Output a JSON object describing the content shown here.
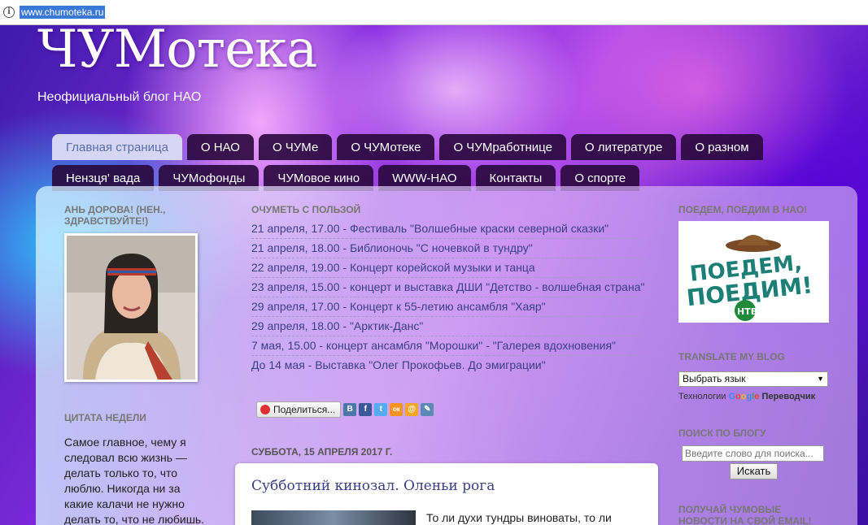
{
  "browser": {
    "url": "www.chumoteka.ru"
  },
  "header": {
    "title": "ЧУМотека",
    "subtitle": "Неофициальный блог НАО"
  },
  "tabs": [
    {
      "label": "Главная страница",
      "active": true
    },
    {
      "label": "О НАО"
    },
    {
      "label": "О ЧУМе"
    },
    {
      "label": "О ЧУМотеке"
    },
    {
      "label": "О ЧУМработнице"
    },
    {
      "label": "О литературе"
    },
    {
      "label": "О разном"
    },
    {
      "label": "Нензця' вада"
    },
    {
      "label": "ЧУМофонды"
    },
    {
      "label": "ЧУМовое кино"
    },
    {
      "label": "WWW-НАО"
    },
    {
      "label": "Контакты"
    },
    {
      "label": "О спорте"
    }
  ],
  "left": {
    "greeting_title": "АНЬ ДОРОВА! (НЕН., ЗДРАВСТВУЙТЕ!)",
    "quote_title": "ЦИТАТА НЕДЕЛИ",
    "quote_text": "Самое главное, чему я следовал всю жизнь — делать только то, что люблю. Никогда ни за какие калачи не нужно делать то, что не любишь."
  },
  "center": {
    "events_title": "ОЧУМЕТЬ С ПОЛЬЗОЙ",
    "events": [
      "21 апреля, 17.00 - Фестиваль \"Волшебные краски северной сказки\"",
      "21 апреля, 18.00 - Библионочь \"С ночевкой в тундру\"",
      "22 апреля, 19.00 - Концерт корейской музыки и танца",
      "23 апреля, 15.00 - концерт и выставка ДШИ \"Детство - волшебная страна\"",
      "29 апреля, 17.00 - Концерт к 55-летию ансамбля \"Хаяр\"",
      "29 апреля, 18.00 - \"Арктик-Данс\"",
      "7 мая, 15.00 - концерт ансамбля \"Морошки\" - \"Галерея вдохновения\"",
      "До 14 мая - Выставка \"Олег Прокофьев. До эмиграции\""
    ],
    "share_label": "Поделиться...",
    "social": [
      {
        "icon": "vk-icon",
        "glyph": "В",
        "color": "#4a76a8"
      },
      {
        "icon": "facebook-icon",
        "glyph": "f",
        "color": "#3b5998"
      },
      {
        "icon": "twitter-icon",
        "glyph": "t",
        "color": "#55acee"
      },
      {
        "icon": "odnoklassniki-icon",
        "glyph": "ок",
        "color": "#f7931e"
      },
      {
        "icon": "mailru-icon",
        "glyph": "@",
        "color": "#f5a623"
      },
      {
        "icon": "livejournal-icon",
        "glyph": "✎",
        "color": "#5a8ab5"
      }
    ],
    "post_date": "СУББОТА, 15 АПРЕЛЯ 2017 Г.",
    "post_title": "Субботний кинозал. Оленьи рога",
    "post_excerpt": "То ли духи тундры виноваты, то ли"
  },
  "right": {
    "banner_title": "ПОЕДЕМ, ПОЕДИМ В НАО!",
    "banner_text_1": "ПОЕДЕМ,",
    "banner_text_2": "ПОЕДИМ!",
    "banner_logo": "НТВ",
    "translate_title": "TRANSLATE MY BLOG",
    "language_select": "Выбрать язык",
    "powered_prefix": "Технологии",
    "powered_suffix": "Переводчик",
    "search_title": "ПОИСК ПО БЛОГУ",
    "search_placeholder": "Введите слово для поиска...",
    "search_button": "Искать",
    "subscribe_title": "ПОЛУЧАЙ ЧУМОВЫЕ НОВОСТИ НА СВОЙ EMAIL!"
  }
}
